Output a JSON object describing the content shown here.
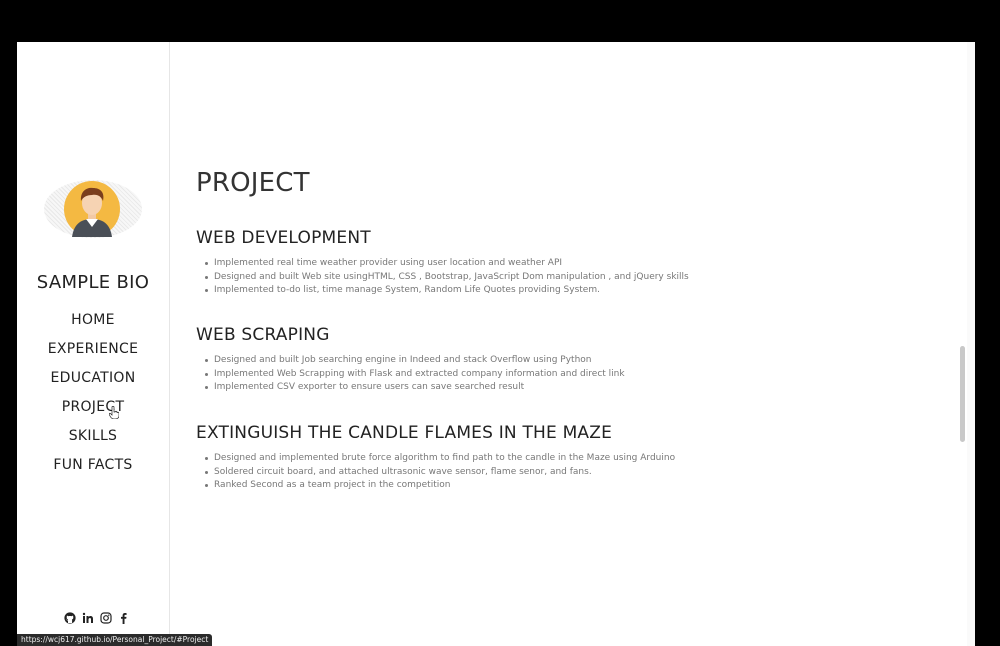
{
  "sidebar": {
    "bio_title": "SAMPLE BIO",
    "nav": [
      {
        "label": "HOME"
      },
      {
        "label": "EXPERIENCE"
      },
      {
        "label": "EDUCATION"
      },
      {
        "label": "PROJECT"
      },
      {
        "label": "SKILLS"
      },
      {
        "label": "FUN FACTS"
      }
    ],
    "social_icons": [
      "github-icon",
      "linkedin-icon",
      "instagram-icon",
      "facebook-icon"
    ]
  },
  "status_bar": {
    "url": "https://wcj617.github.io/Personal_Project/#Project"
  },
  "main": {
    "page_title": "PROJECT",
    "sections": [
      {
        "title": "WEB DEVELOPMENT",
        "items": [
          "Implemented real time weather provider using user location and weather API",
          "Designed and built Web site usingHTML, CSS , Bootstrap, JavaScript Dom manipulation , and jQuery skills",
          "Implemented to-do list, time manage System, Random Life Quotes providing System."
        ]
      },
      {
        "title": "WEB SCRAPING",
        "items": [
          "Designed and built Job searching engine in Indeed and stack Overflow using Python",
          "Implemented Web Scrapping with Flask and extracted company information and direct link",
          "Implemented CSV exporter to ensure users can save searched result"
        ]
      },
      {
        "title": "EXTINGUISH THE CANDLE FLAMES IN THE MAZE",
        "items": [
          "Designed and implemented brute force algorithm to find path to the candle in the Maze using Arduino",
          "Soldered circuit board, and attached ultrasonic wave sensor, flame senor, and fans.",
          "Ranked Second as a team project in the competition"
        ]
      }
    ]
  },
  "colors": {
    "text_dark": "#222222",
    "text_muted": "#777777",
    "avatar_bg": "#f4b942",
    "status_bar_bg": "#2b2b2b"
  }
}
